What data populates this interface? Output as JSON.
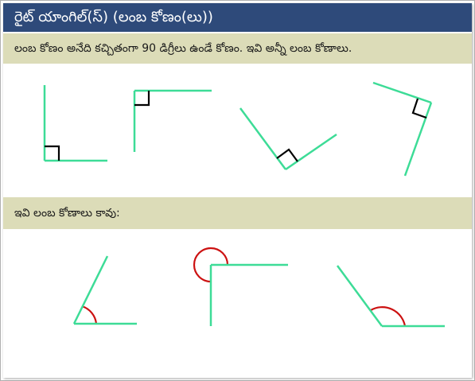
{
  "title": "రైట్ యాంగిల్(స్) (లంబ కోణం(లు))",
  "right_angles_caption": "లంబ కోణం అనేది కచ్చితంగా 90 డిగ్రీలు ఉండే కోణం. ఇవి అన్నీ లంబ కోణాలు.",
  "not_right_angles_caption": "ఇవి లంబ కోణాలు కావు:",
  "colors": {
    "title_bg": "#2e4a7a",
    "band_bg": "#dcdcb8",
    "arm": "#3ddc97",
    "right_angle_marker": "#000000",
    "non_right_arc": "#cc1111"
  },
  "right_angles": [
    {
      "rotation_deg": 0,
      "marker": "square"
    },
    {
      "rotation_deg": 90,
      "marker": "square"
    },
    {
      "rotation_deg": -45,
      "marker": "square"
    },
    {
      "rotation_deg": 110,
      "marker": "square"
    }
  ],
  "non_right_angles": [
    {
      "kind": "acute",
      "degrees": 60,
      "marker": "arc"
    },
    {
      "kind": "reflex",
      "degrees": 270,
      "marker": "arc"
    },
    {
      "kind": "obtuse",
      "degrees": 125,
      "marker": "arc"
    }
  ]
}
